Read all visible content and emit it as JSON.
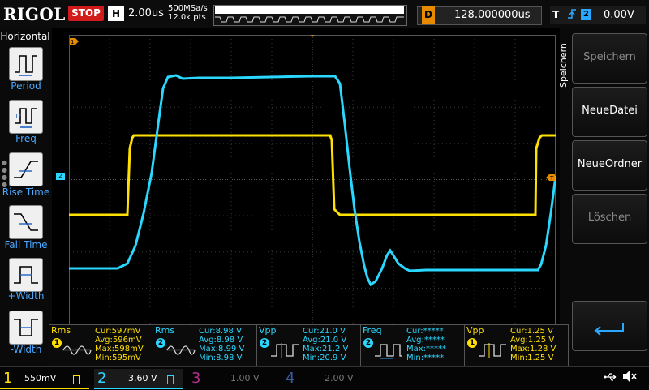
{
  "top": {
    "brand": "RIGOL",
    "run_state": "STOP",
    "timebase_label": "H",
    "timebase": "2.00us",
    "sample_rate": "500MSa/s",
    "memory_depth": "12.0k pts",
    "delay_label": "D",
    "delay": "128.000000us",
    "trigger_label": "T",
    "trigger_edge": "rising-edge-icon",
    "trigger_source": "2",
    "trigger_level": "0.00V"
  },
  "left_menu": {
    "title": "Horizontal",
    "items": [
      {
        "label": "Period",
        "icon": "period-icon"
      },
      {
        "label": "Freq",
        "icon": "frequency-icon"
      },
      {
        "label": "Rise Time",
        "icon": "rise-time-icon"
      },
      {
        "label": "Fall Time",
        "icon": "fall-time-icon"
      },
      {
        "label": "+Width",
        "icon": "positive-width-icon"
      },
      {
        "label": "-Width",
        "icon": "negative-width-icon"
      }
    ]
  },
  "right_menu": {
    "title": "Speichern",
    "softkeys": [
      {
        "label": "Speichern",
        "state": "disabled"
      },
      {
        "label": "NeueDatei",
        "state": "enabled"
      },
      {
        "label": "NeueOrdner",
        "state": "enabled"
      },
      {
        "label": "Löschen",
        "state": "disabled"
      }
    ],
    "return_icon": "return-arrow-icon"
  },
  "markers": {
    "ch1_ground": "1",
    "ch2_ground": "2",
    "trigger_level_marker": "T"
  },
  "measurements": [
    {
      "name": "Rms",
      "channel": "1",
      "color": "#ffe000",
      "cur_label": "Cur:",
      "cur": "597mV",
      "avg_label": "Avg:",
      "avg": "596mV",
      "max_label": "Max:",
      "max": "598mV",
      "min_label": "Min:",
      "min": "595mV"
    },
    {
      "name": "Rms",
      "channel": "2",
      "color": "#2ad8ff",
      "cur_label": "Cur:",
      "cur": "8.98 V",
      "avg_label": "Avg:",
      "avg": "8.98 V",
      "max_label": "Max:",
      "max": "8.99 V",
      "min_label": "Min:",
      "min": "8.98 V"
    },
    {
      "name": "Vpp",
      "channel": "2",
      "color": "#2ad8ff",
      "cur_label": "Cur:",
      "cur": "21.0 V",
      "avg_label": "Avg:",
      "avg": "21.0 V",
      "max_label": "Max:",
      "max": "21.2 V",
      "min_label": "Min:",
      "min": "20.9 V"
    },
    {
      "name": "Freq",
      "channel": "2",
      "color": "#2ad8ff",
      "cur_label": "Cur:",
      "cur": "*****",
      "avg_label": "Avg:",
      "avg": "*****",
      "max_label": "Max:",
      "max": "*****",
      "min_label": "Min:",
      "min": "*****"
    },
    {
      "name": "Vpp",
      "channel": "1",
      "color": "#ffe000",
      "cur_label": "Cur:",
      "cur": "1.25 V",
      "avg_label": "Avg:",
      "avg": "1.25 V",
      "max_label": "Max:",
      "max": "1.28 V",
      "min_label": "Min:",
      "min": "1.25 V"
    }
  ],
  "channels": [
    {
      "num": "1",
      "scale": "550mV",
      "color": "#ffe000",
      "active": true
    },
    {
      "num": "2",
      "scale": "3.60 V",
      "color": "#2ad8ff",
      "active": true
    },
    {
      "num": "3",
      "scale": "1.00 V",
      "color": "#b0308a",
      "active": false
    },
    {
      "num": "4",
      "scale": "2.00 V",
      "color": "#3a5aa0",
      "active": false
    }
  ],
  "status_icons": [
    "usb-icon",
    "speaker-muted-icon"
  ],
  "colors": {
    "ch1": "#ffe000",
    "ch2": "#2ad8ff",
    "stop": "#d11a1a",
    "menu_text": "#4aa8ff",
    "delay_badge": "#e68a00"
  }
}
